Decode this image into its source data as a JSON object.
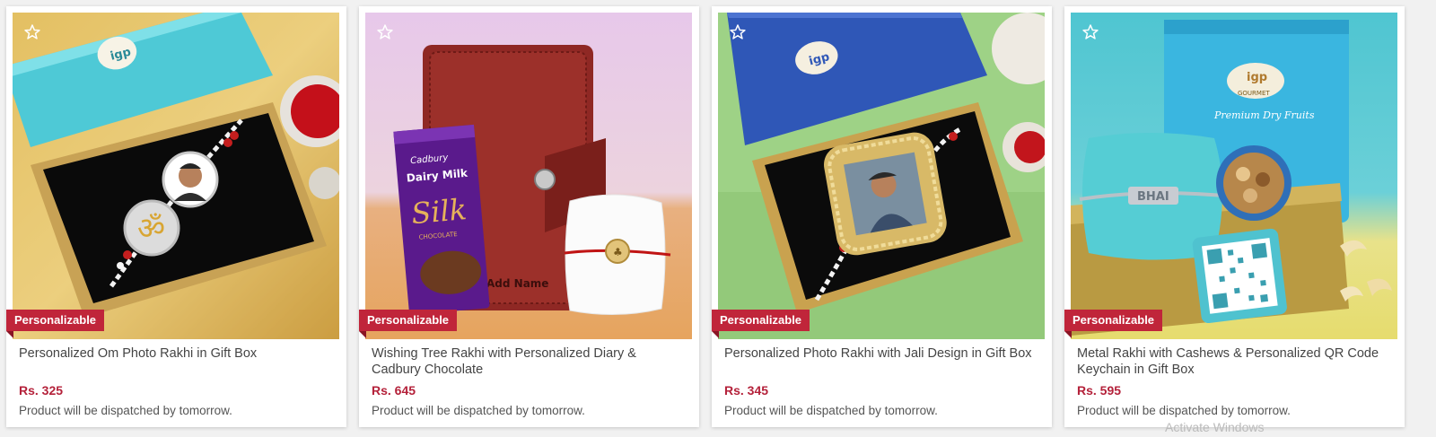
{
  "products": [
    {
      "title": "Personalized Om Photo Rakhi in Gift Box",
      "price": "Rs. 325",
      "dispatch": "Product will be dispatched by tomorrow.",
      "badge": "Personalizable",
      "wishlist_icon": "star-outline-icon"
    },
    {
      "title": "Wishing Tree Rakhi with Personalized Diary & Cadbury Chocolate",
      "price": "Rs. 645",
      "dispatch": "Product will be dispatched by tomorrow.",
      "badge": "Personalizable",
      "wishlist_icon": "star-outline-icon",
      "image_text": {
        "brand": "Cadbury",
        "product": "Dairy Milk",
        "variant": "Silk",
        "subvariant": "CHOCOLATE",
        "diary_text": "Add Name"
      }
    },
    {
      "title": "Personalized Photo Rakhi with Jali Design in Gift Box",
      "price": "Rs. 345",
      "dispatch": "Product will be dispatched by tomorrow.",
      "badge": "Personalizable",
      "wishlist_icon": "star-outline-icon"
    },
    {
      "title": "Metal Rakhi with Cashews & Personalized QR Code Keychain in Gift Box",
      "price": "Rs. 595",
      "dispatch": "Product will be dispatched by tomorrow.",
      "badge": "Personalizable",
      "wishlist_icon": "star-outline-icon",
      "image_text": {
        "pouch_brand": "igp",
        "pouch_sub": "GOURMET",
        "pouch_label": "Premium Dry Fruits",
        "rakhi_text": "BHAI"
      }
    }
  ],
  "image_text": {
    "box_brand": "igp"
  },
  "footer_ghost_text": "Activate Windows",
  "colors": {
    "badge": "#c0253a",
    "price": "#b4213a",
    "text": "#444444"
  }
}
